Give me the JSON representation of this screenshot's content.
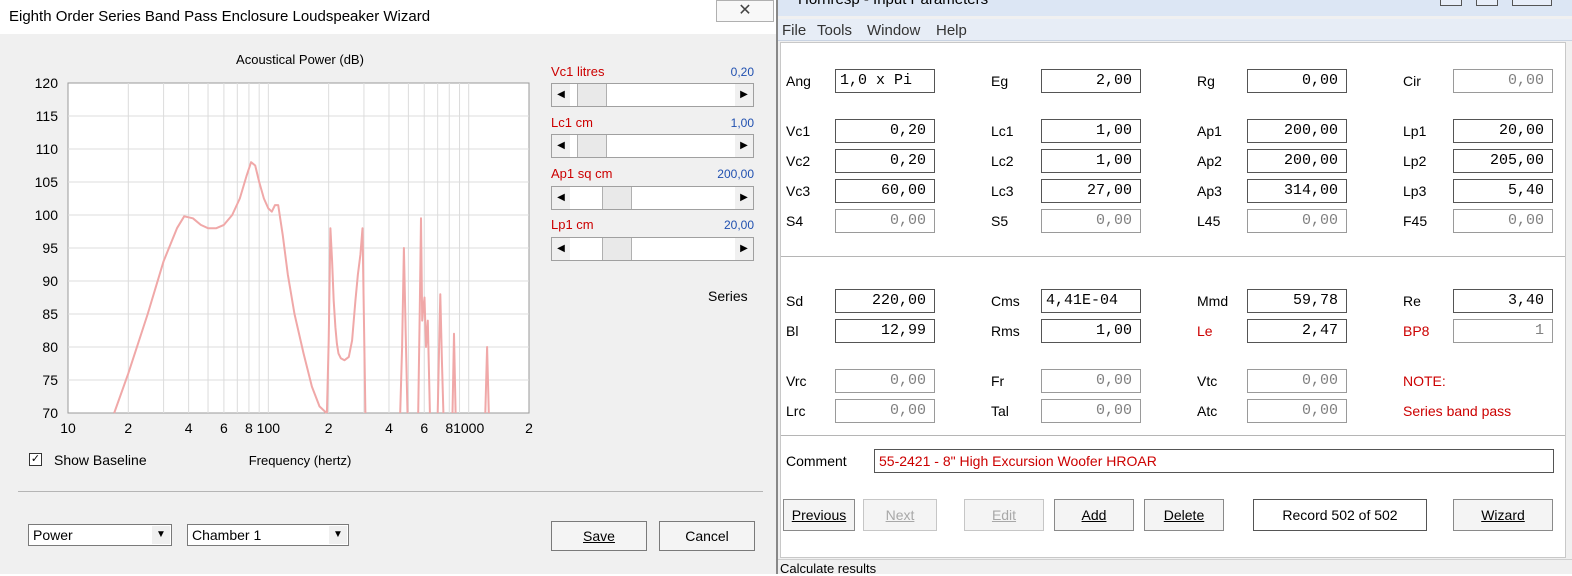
{
  "main": {
    "title": "Hornresp - Input Parameters",
    "menu": [
      "File",
      "Tools",
      "Window",
      "Help"
    ],
    "params": {
      "ang": {
        "label": "Ang",
        "value": "1,0 x Pi"
      },
      "eg": {
        "label": "Eg",
        "value": "2,00"
      },
      "rg": {
        "label": "Rg",
        "value": "0,00"
      },
      "cir": {
        "label": "Cir",
        "value": "0,00"
      },
      "vc1": {
        "label": "Vc1",
        "value": "0,20"
      },
      "lc1": {
        "label": "Lc1",
        "value": "1,00"
      },
      "ap1": {
        "label": "Ap1",
        "value": "200,00"
      },
      "lp1": {
        "label": "Lp1",
        "value": "20,00"
      },
      "vc2": {
        "label": "Vc2",
        "value": "0,20"
      },
      "lc2": {
        "label": "Lc2",
        "value": "1,00"
      },
      "ap2": {
        "label": "Ap2",
        "value": "200,00"
      },
      "lp2": {
        "label": "Lp2",
        "value": "205,00"
      },
      "vc3": {
        "label": "Vc3",
        "value": "60,00"
      },
      "lc3": {
        "label": "Lc3",
        "value": "27,00"
      },
      "ap3": {
        "label": "Ap3",
        "value": "314,00"
      },
      "lp3": {
        "label": "Lp3",
        "value": "5,40"
      },
      "s4": {
        "label": "S4",
        "value": "0,00"
      },
      "s5": {
        "label": "S5",
        "value": "0,00"
      },
      "l45": {
        "label": "L45",
        "value": "0,00"
      },
      "f45": {
        "label": "F45",
        "value": "0,00"
      },
      "sd": {
        "label": "Sd",
        "value": "220,00"
      },
      "cms": {
        "label": "Cms",
        "value": "4,41E-04"
      },
      "mmd": {
        "label": "Mmd",
        "value": "59,78"
      },
      "re": {
        "label": "Re",
        "value": "3,40"
      },
      "bl": {
        "label": "Bl",
        "value": "12,99"
      },
      "rms": {
        "label": "Rms",
        "value": "1,00"
      },
      "le": {
        "label": "Le",
        "value": "2,47"
      },
      "bp8": {
        "label": "BP8",
        "value": "1"
      },
      "vrc": {
        "label": "Vrc",
        "value": "0,00"
      },
      "fr": {
        "label": "Fr",
        "value": "0,00"
      },
      "vtc": {
        "label": "Vtc",
        "value": "0,00"
      },
      "lrc": {
        "label": "Lrc",
        "value": "0,00"
      },
      "tal": {
        "label": "Tal",
        "value": "0,00"
      },
      "atc": {
        "label": "Atc",
        "value": "0,00"
      }
    },
    "note_label": "NOTE:",
    "note_text": "Series band pass",
    "comment_label": "Comment",
    "comment_value": "55-2421 -  8\" High Excursion Woofer HROAR",
    "buttons": {
      "previous": "Previous",
      "next": "Next",
      "edit": "Edit",
      "add": "Add",
      "delete": "Delete",
      "record": "Record 502 of 502",
      "wizard": "Wizard"
    },
    "status": "Calculate results"
  },
  "wizard": {
    "title": "Eighth Order Series Band Pass Enclosure Loudspeaker Wizard",
    "close": "✕",
    "series_label": "Series",
    "sliders": [
      {
        "label": "Vc1  litres",
        "value": "0,20",
        "position": 0.05
      },
      {
        "label": "Lc1  cm",
        "value": "1,00",
        "position": 0.05
      },
      {
        "label": "Ap1  sq cm",
        "value": "200,00",
        "position": 0.24
      },
      {
        "label": "Lp1  cm",
        "value": "20,00",
        "position": 0.24
      }
    ],
    "show_baseline_label": "Show Baseline",
    "show_baseline_checked": "✓",
    "combo_type": "Power",
    "combo_chamber": "Chamber 1",
    "save_label": "Save",
    "cancel_label": "Cancel"
  },
  "chart_data": {
    "type": "line",
    "title": "Acoustical Power (dB)",
    "xlabel": "Frequency (hertz)",
    "ylabel": "",
    "x_scale": "log",
    "xlim": [
      10,
      2000
    ],
    "ylim": [
      70,
      120
    ],
    "y_ticks": [
      "120",
      "115",
      "110",
      "105",
      "100",
      "95",
      "90",
      "85",
      "80",
      "75",
      "70"
    ],
    "x_tick_labels": [
      {
        "x": 10,
        "label": "10"
      },
      {
        "x": 20,
        "label": "2"
      },
      {
        "x": 40,
        "label": "4"
      },
      {
        "x": 60,
        "label": "6"
      },
      {
        "x": 80,
        "label": "8"
      },
      {
        "x": 100,
        "label": "100"
      },
      {
        "x": 200,
        "label": "2"
      },
      {
        "x": 400,
        "label": "4"
      },
      {
        "x": 600,
        "label": "6"
      },
      {
        "x": 800,
        "label": "8"
      },
      {
        "x": 1000,
        "label": "1000"
      },
      {
        "x": 2000,
        "label": "2"
      }
    ],
    "color": "#f0a8a8",
    "series": [
      {
        "x": [
          17,
          20,
          25,
          30,
          35,
          38,
          42,
          46,
          50,
          55,
          60,
          66,
          72,
          78,
          82,
          86,
          90,
          95,
          100,
          104,
          108,
          112,
          118,
          125,
          135,
          150,
          165,
          180,
          195
        ],
        "y": [
          70,
          76,
          85,
          93,
          98,
          99.8,
          99.5,
          98.5,
          98,
          98,
          98.5,
          100,
          102.5,
          106,
          108,
          107.5,
          105,
          102.5,
          101,
          100.5,
          101.5,
          101.5,
          97,
          91,
          85,
          79,
          74,
          71,
          70
        ]
      },
      {
        "x": [
          196,
          200,
          204,
          208,
          212,
          216,
          220,
          224,
          230,
          240,
          252,
          262,
          272,
          280,
          288,
          295,
          305
        ],
        "y": [
          70,
          81,
          98,
          93,
          87,
          83,
          80.5,
          79,
          78.3,
          78,
          78.5,
          81,
          87,
          91,
          94,
          98,
          70
        ]
      },
      {
        "x": [
          455,
          465,
          475,
          485,
          495
        ],
        "y": [
          70,
          80,
          95,
          82,
          70
        ]
      },
      {
        "x": [
          560,
          570,
          578,
          586,
          594,
          602,
          612,
          625,
          640
        ],
        "y": [
          70,
          86,
          99.5,
          84,
          86,
          87.5,
          80,
          84,
          70
        ]
      },
      {
        "x": [
          700,
          712,
          722,
          735,
          748
        ],
        "y": [
          70,
          80,
          88,
          78,
          70
        ]
      },
      {
        "x": [
          830,
          845,
          860
        ],
        "y": [
          70,
          82,
          70
        ]
      },
      {
        "x": [
          1210,
          1235,
          1260
        ],
        "y": [
          70,
          80,
          70
        ]
      }
    ]
  }
}
